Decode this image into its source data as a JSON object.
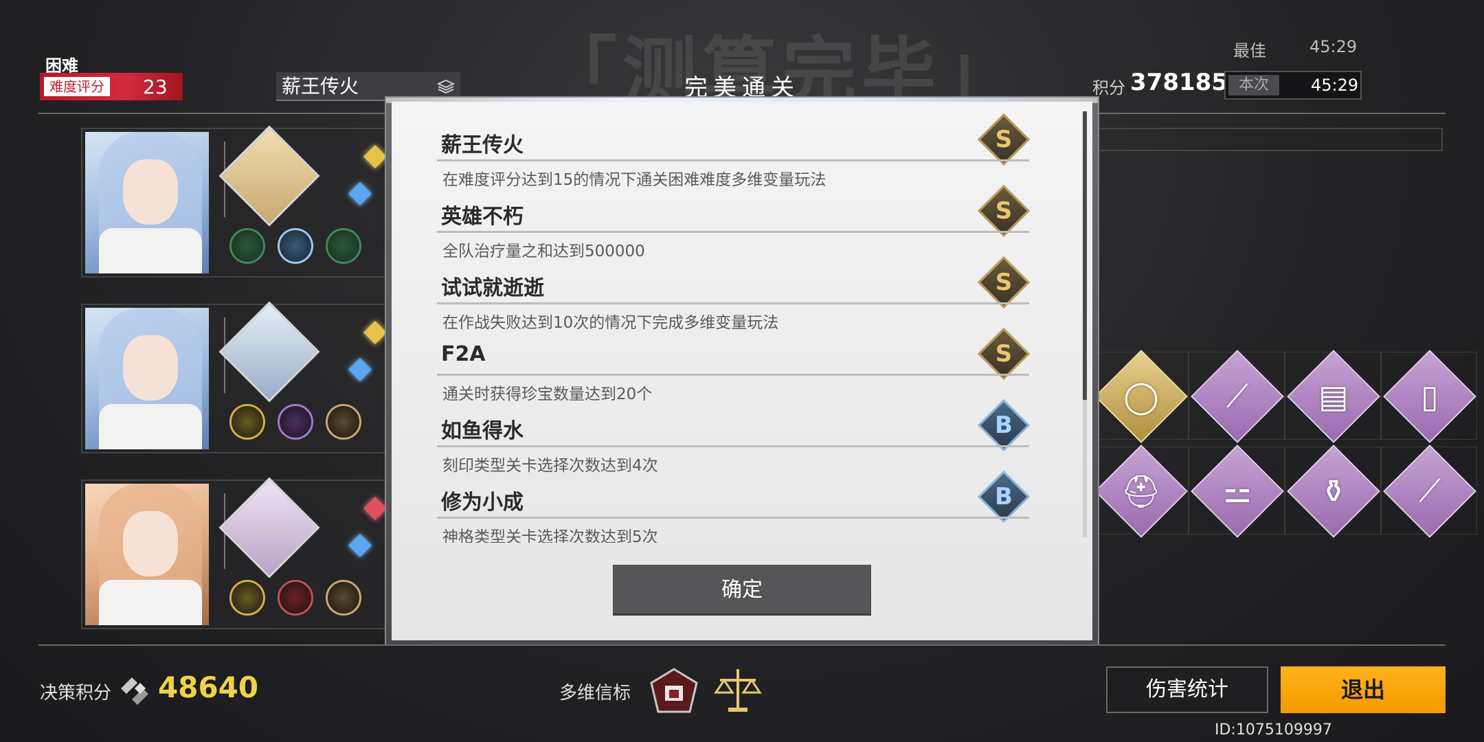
{
  "header": {
    "big_title": "「测算完毕」",
    "difficulty": "困难",
    "difficulty_tag": "难度评分",
    "difficulty_value": "23",
    "mode_name": "薪王传火",
    "perfect_clear": "完美通关",
    "score_label": "积分",
    "score_value": "378185",
    "best_label": "最佳",
    "best_time": "45:29",
    "this_label": "本次",
    "this_time": "45:29"
  },
  "modal": {
    "achievements": [
      {
        "title": "薪王传火",
        "desc": "在难度评分达到15的情况下通关困难难度多维变量玩法",
        "rank": "S"
      },
      {
        "title": "英雄不朽",
        "desc": "全队治疗量之和达到500000",
        "rank": "S"
      },
      {
        "title": "试试就逝逝",
        "desc": "在作战失败达到10次的情况下完成多维变量玩法",
        "rank": "S"
      },
      {
        "title": "F2A",
        "desc": "通关时获得珍宝数量达到20个",
        "rank": "S"
      },
      {
        "title": "如鱼得水",
        "desc": "刻印类型关卡选择次数达到4次",
        "rank": "B"
      },
      {
        "title": "修为小成",
        "desc": "神格类型关卡选择次数达到5次",
        "rank": "B"
      }
    ],
    "confirm_label": "确定"
  },
  "footer": {
    "decision_label": "决策积分",
    "decision_value": "48640",
    "sigil_label": "多维信标",
    "damage_stats_label": "伤害统计",
    "exit_label": "退出",
    "user_id": "ID:1075109997"
  },
  "items": [
    {
      "icon": "frying-pan-icon",
      "glyph": "◯",
      "style": "gold"
    },
    {
      "icon": "baguette-icon",
      "glyph": "⟋",
      "style": "purple"
    },
    {
      "icon": "film-roll-icon",
      "glyph": "▤",
      "style": "purple"
    },
    {
      "icon": "card-icon",
      "glyph": "▯",
      "style": "purple"
    },
    {
      "icon": "helmet-icon",
      "glyph": "⛑",
      "style": "purple"
    },
    {
      "icon": "dumbbell-icon",
      "glyph": "⚍",
      "style": "purple"
    },
    {
      "icon": "perfume-icon",
      "glyph": "⚱",
      "style": "purple"
    },
    {
      "icon": "lipstick-icon",
      "glyph": "⟋",
      "style": "purple"
    }
  ],
  "colors": {
    "accent_red": "#d42b3a",
    "exit_orange": "#f59a00",
    "decision_gold": "#f0d24a"
  }
}
